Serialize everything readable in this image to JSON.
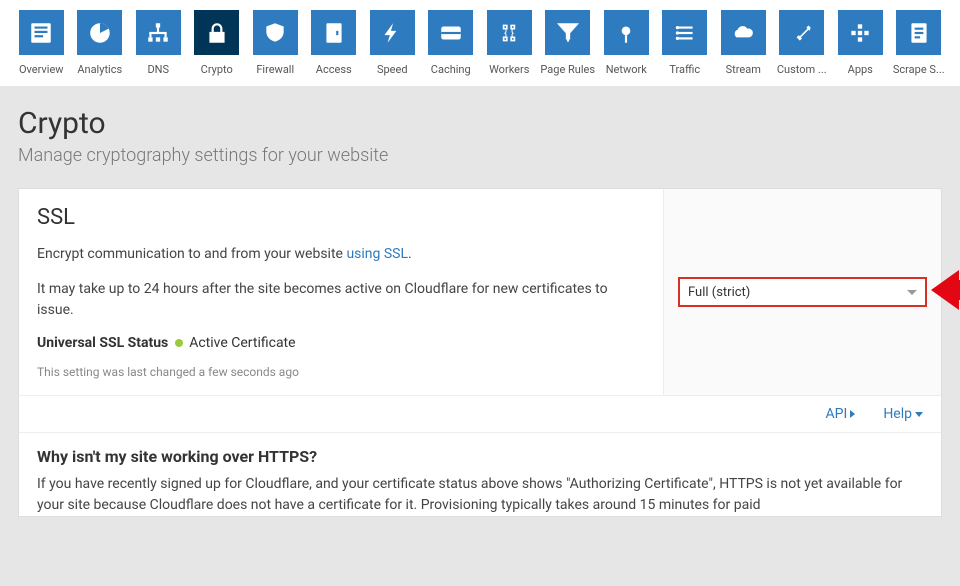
{
  "nav": [
    {
      "label": "Overview",
      "icon": "overview"
    },
    {
      "label": "Analytics",
      "icon": "analytics"
    },
    {
      "label": "DNS",
      "icon": "dns"
    },
    {
      "label": "Crypto",
      "icon": "crypto",
      "active": true
    },
    {
      "label": "Firewall",
      "icon": "firewall"
    },
    {
      "label": "Access",
      "icon": "access"
    },
    {
      "label": "Speed",
      "icon": "speed"
    },
    {
      "label": "Caching",
      "icon": "caching"
    },
    {
      "label": "Workers",
      "icon": "workers"
    },
    {
      "label": "Page Rules",
      "icon": "pagerules"
    },
    {
      "label": "Network",
      "icon": "network"
    },
    {
      "label": "Traffic",
      "icon": "traffic"
    },
    {
      "label": "Stream",
      "icon": "stream"
    },
    {
      "label": "Custom ...",
      "icon": "custom"
    },
    {
      "label": "Apps",
      "icon": "apps"
    },
    {
      "label": "Scrape S...",
      "icon": "scrape"
    }
  ],
  "page": {
    "title": "Crypto",
    "subtitle": "Manage cryptography settings for your website"
  },
  "ssl": {
    "title": "SSL",
    "desc_prefix": "Encrypt communication to and from your website ",
    "desc_link": "using SSL",
    "desc_suffix": ".",
    "note": "It may take up to 24 hours after the site becomes active on Cloudflare for new certificates to issue.",
    "status_label": "Universal SSL Status",
    "status_value": "Active Certificate",
    "meta": "This setting was last changed a few seconds ago",
    "select_value": "Full (strict)"
  },
  "footer": {
    "api": "API",
    "help": "Help"
  },
  "faq": {
    "title": "Why isn't my site working over HTTPS?",
    "text": "If you have recently signed up for Cloudflare, and your certificate status above shows \"Authorizing Certificate\", HTTPS is not yet available for your site because Cloudflare does not have a certificate for it. Provisioning typically takes around 15 minutes for paid"
  }
}
